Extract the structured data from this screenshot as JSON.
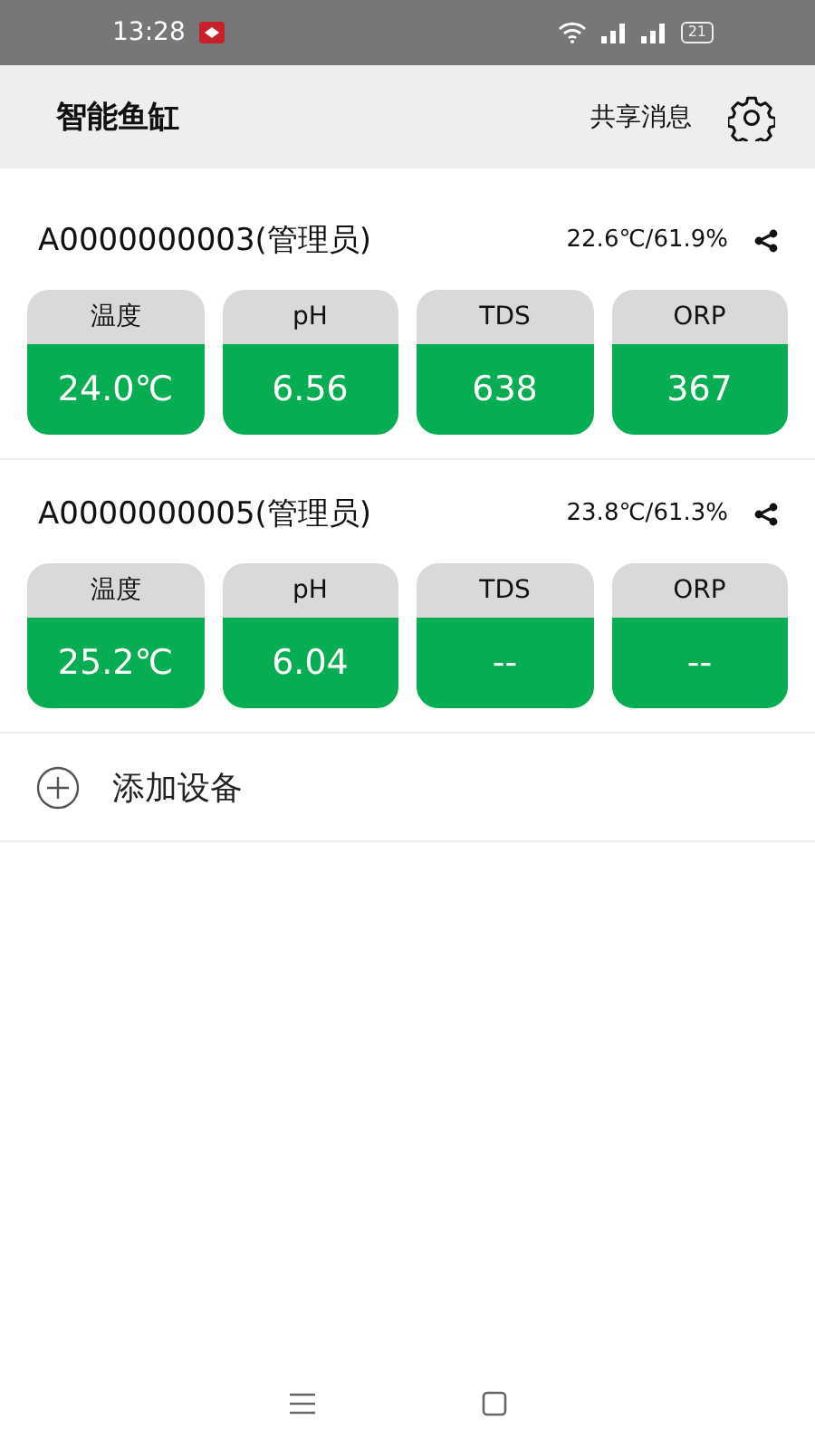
{
  "status_bar": {
    "time": "13:28",
    "battery": "21"
  },
  "header": {
    "title": "智能鱼缸",
    "share_messages": "共享消息"
  },
  "devices": [
    {
      "name": "A0000000003(管理员)",
      "climate": "22.6℃/61.9%",
      "readings": [
        {
          "label": "温度",
          "value": "24.0℃"
        },
        {
          "label": "pH",
          "value": "6.56"
        },
        {
          "label": "TDS",
          "value": "638"
        },
        {
          "label": "ORP",
          "value": "367"
        }
      ]
    },
    {
      "name": "A0000000005(管理员)",
      "climate": "23.8℃/61.3%",
      "readings": [
        {
          "label": "温度",
          "value": "25.2℃"
        },
        {
          "label": "pH",
          "value": "6.04"
        },
        {
          "label": "TDS",
          "value": "--"
        },
        {
          "label": "ORP",
          "value": "--"
        }
      ]
    }
  ],
  "add_device": "添加设备"
}
